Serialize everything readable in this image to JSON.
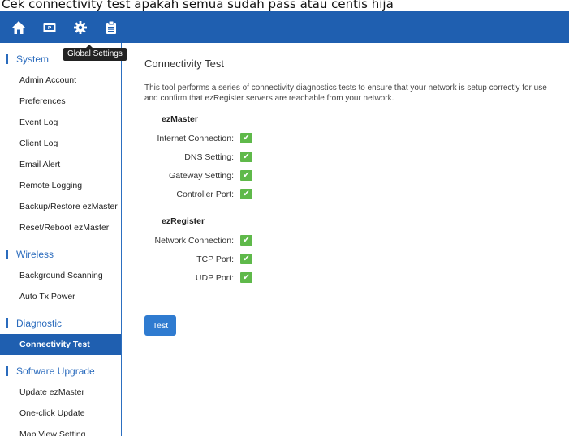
{
  "caption": "Cek connectivity test apakah semua sudah pass atau centis hija",
  "topbar": {
    "icons": [
      "home-icon",
      "dashboard-icon",
      "gear-icon",
      "clipboard-icon"
    ],
    "tooltip": "Global Settings"
  },
  "sidebar": {
    "system": {
      "title": "System",
      "items": [
        "Admin Account",
        "Preferences",
        "Event Log",
        "Client Log",
        "Email Alert",
        "Remote Logging",
        "Backup/Restore ezMaster",
        "Reset/Reboot ezMaster"
      ]
    },
    "wireless": {
      "title": "Wireless",
      "items": [
        "Background Scanning",
        "Auto Tx Power"
      ]
    },
    "diagnostic": {
      "title": "Diagnostic",
      "items": [
        "Connectivity Test"
      ]
    },
    "software": {
      "title": "Software Upgrade",
      "items": [
        "Update ezMaster",
        "One-click Update",
        "Map View Setting"
      ]
    }
  },
  "main": {
    "title": "Connectivity Test",
    "desc_line1": "This tool performs a series of connectivity diagnostics tests to ensure that your network is setup correctly for use",
    "desc_line2": "and confirm that ezRegister servers are reachable from your network.",
    "ezmaster": {
      "title": "ezMaster",
      "rows": [
        "Internet Connection:",
        "DNS Setting:",
        "Gateway Setting:",
        "Controller Port:"
      ]
    },
    "ezregister": {
      "title": "ezRegister",
      "rows": [
        "Network Connection:",
        "TCP Port:",
        "UDP Port:"
      ]
    },
    "check_glyph": "✔",
    "test_button": "Test"
  },
  "colors": {
    "topbar": "#1f5fb0",
    "accent": "#2a6bbd",
    "check": "#5fb94a",
    "button": "#2f7bd0"
  }
}
